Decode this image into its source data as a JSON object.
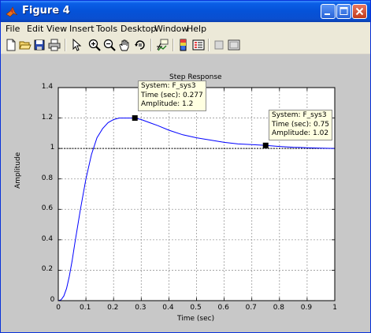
{
  "window": {
    "title": "Figure 4",
    "accent_color": "#0a5ee6",
    "figure_background": "#c8c8c8"
  },
  "window_controls": [
    "minimize-icon",
    "maximize-icon",
    "close-icon"
  ],
  "menu": [
    "File",
    "Edit",
    "View",
    "Insert",
    "Tools",
    "Desktop",
    "Window",
    "Help"
  ],
  "toolbar_icons": [
    "new-figure-icon",
    "open-file-icon",
    "save-icon",
    "print-icon",
    "edit-plot-arrow-icon",
    "zoom-in-icon",
    "zoom-out-icon",
    "pan-hand-icon",
    "rotate-3d-icon",
    "data-cursor-icon",
    "colorbar-icon",
    "legend-icon",
    "hide-plot-tools-icon",
    "show-plot-tools-icon"
  ],
  "plot": {
    "title": "Step Response",
    "xlabel": "Time (sec)",
    "ylabel": "Amplitude",
    "line_color": "#0000ff"
  },
  "chart_data": {
    "type": "line",
    "title": "Step Response",
    "xlabel": "Time (sec)",
    "ylabel": "Amplitude",
    "xlim": [
      0,
      1
    ],
    "ylim": [
      0,
      1.4
    ],
    "x_ticks": [
      "0",
      "0.1",
      "0.2",
      "0.3",
      "0.4",
      "0.5",
      "0.6",
      "0.7",
      "0.8",
      "0.9",
      "1"
    ],
    "y_ticks": [
      "0",
      "0.2",
      "0.4",
      "0.6",
      "0.8",
      "1",
      "1.2",
      "1.4"
    ],
    "grid": true,
    "reference_line": 1,
    "series": [
      {
        "x": [
          0,
          0.01,
          0.02,
          0.03,
          0.04,
          0.05,
          0.06,
          0.08,
          0.1,
          0.12,
          0.14,
          0.16,
          0.18,
          0.2,
          0.22,
          0.24,
          0.26,
          0.277,
          0.3,
          0.33,
          0.36,
          0.4,
          0.45,
          0.5,
          0.55,
          0.6,
          0.65,
          0.7,
          0.75,
          0.8,
          0.85,
          0.9,
          0.95,
          1.0
        ],
        "y": [
          0,
          0.005,
          0.03,
          0.08,
          0.16,
          0.26,
          0.38,
          0.6,
          0.8,
          0.96,
          1.07,
          1.13,
          1.17,
          1.19,
          1.2,
          1.2,
          1.2,
          1.2,
          1.19,
          1.17,
          1.15,
          1.12,
          1.09,
          1.07,
          1.055,
          1.04,
          1.03,
          1.025,
          1.02,
          1.013,
          1.008,
          1.005,
          1.002,
          1.0
        ]
      }
    ],
    "datatips": [
      {
        "system": "System: F_sys3",
        "time": "Time (sec): 0.277",
        "amplitude": "Amplitude: 1.2",
        "x": 0.277,
        "y": 1.2
      },
      {
        "system": "System: F_sys3",
        "time": "Time (sec): 0.75",
        "amplitude": "Amplitude: 1.02",
        "x": 0.75,
        "y": 1.02
      }
    ]
  }
}
